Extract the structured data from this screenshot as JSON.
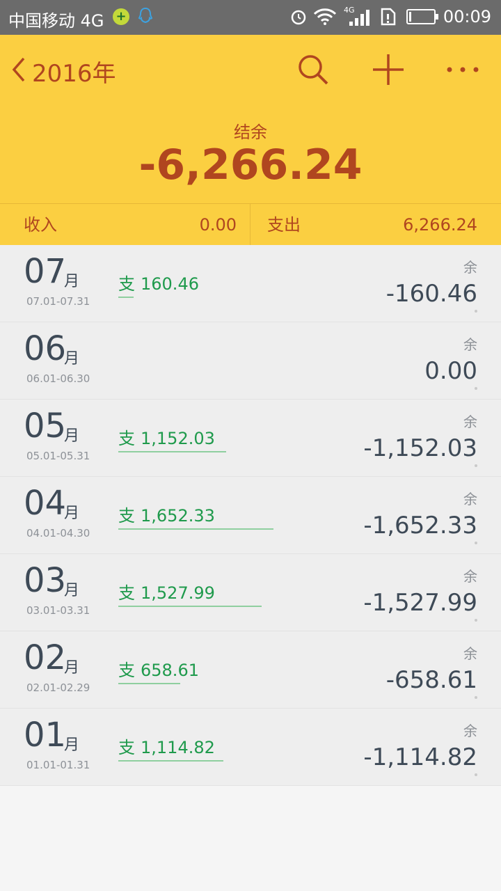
{
  "status_bar": {
    "carrier": "中国移动 4G",
    "network_tag": "4G",
    "time": "00:09",
    "battery_level": 0.08
  },
  "header": {
    "back_label": "2016年",
    "balance_label": "结余",
    "balance_value": "-6,266.24",
    "income_label": "收入",
    "income_value": "0.00",
    "expense_label": "支出",
    "expense_value": "6,266.24",
    "accent_color": "#fbcf41",
    "text_color": "#b0461f"
  },
  "months": [
    {
      "month": "07",
      "suffix": "月",
      "range": "07.01-07.31",
      "expense_tag": "支",
      "expense": "160.46",
      "expense_ratio": 0.097,
      "balance_label": "余",
      "balance": "-160.46"
    },
    {
      "month": "06",
      "suffix": "月",
      "range": "06.01-06.30",
      "expense_tag": "",
      "expense": "",
      "expense_ratio": 0,
      "balance_label": "余",
      "balance": "0.00"
    },
    {
      "month": "05",
      "suffix": "月",
      "range": "05.01-05.31",
      "expense_tag": "支",
      "expense": "1,152.03",
      "expense_ratio": 0.697,
      "balance_label": "余",
      "balance": "-1,152.03"
    },
    {
      "month": "04",
      "suffix": "月",
      "range": "04.01-04.30",
      "expense_tag": "支",
      "expense": "1,652.33",
      "expense_ratio": 1.0,
      "balance_label": "余",
      "balance": "-1,652.33"
    },
    {
      "month": "03",
      "suffix": "月",
      "range": "03.01-03.31",
      "expense_tag": "支",
      "expense": "1,527.99",
      "expense_ratio": 0.925,
      "balance_label": "余",
      "balance": "-1,527.99"
    },
    {
      "month": "02",
      "suffix": "月",
      "range": "02.01-02.29",
      "expense_tag": "支",
      "expense": "658.61",
      "expense_ratio": 0.399,
      "balance_label": "余",
      "balance": "-658.61"
    },
    {
      "month": "01",
      "suffix": "月",
      "range": "01.01-01.31",
      "expense_tag": "支",
      "expense": "1,114.82",
      "expense_ratio": 0.675,
      "balance_label": "余",
      "balance": "-1,114.82"
    }
  ]
}
